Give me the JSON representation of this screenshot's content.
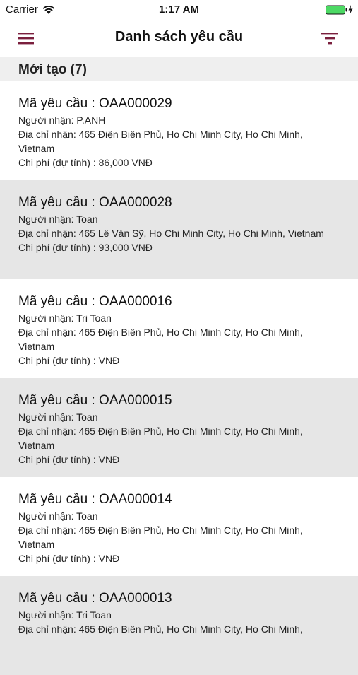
{
  "status_bar": {
    "carrier": "Carrier",
    "time": "1:17 AM"
  },
  "nav": {
    "title": "Danh sách yêu cầu",
    "menu_icon": "hamburger-menu-icon",
    "filter_icon": "filter-icon",
    "accent_color": "#7a1f3d"
  },
  "section": {
    "title": "Mới tạo (7)"
  },
  "labels": {
    "code": "Mã yêu cầu : ",
    "recipient": "Người nhận: ",
    "address": "Địa chỉ nhận: ",
    "cost": "Chi phí (dự tính) : "
  },
  "requests": [
    {
      "code": "Mã yêu cầu : OAA000029",
      "recipient": "Người nhận: P.ANH",
      "address": "Địa chỉ nhận: 465 Điện Biên Phủ, Ho Chi Minh City, Ho Chi Minh, Vietnam",
      "cost": "Chi phí (dự tính) : 86,000 VNĐ"
    },
    {
      "code": "Mã yêu cầu : OAA000028",
      "recipient": "Người nhận: Toan",
      "address": "Địa chỉ nhận: 465 Lê Văn Sỹ, Ho Chi Minh City, Ho Chi Minh, Vietnam",
      "cost": "Chi phí (dự tính) : 93,000 VNĐ"
    },
    {
      "code": "Mã yêu cầu : OAA000016",
      "recipient": "Người nhận: Tri Toan",
      "address": "Địa chỉ nhận: 465 Điện Biên Phủ, Ho Chi Minh City, Ho Chi Minh, Vietnam",
      "cost": "Chi phí (dự tính) :  VNĐ"
    },
    {
      "code": "Mã yêu cầu : OAA000015",
      "recipient": "Người nhận: Toan",
      "address": "Địa chỉ nhận: 465 Điện Biên Phủ, Ho Chi Minh City, Ho Chi Minh, Vietnam",
      "cost": "Chi phí (dự tính) :  VNĐ"
    },
    {
      "code": "Mã yêu cầu : OAA000014",
      "recipient": "Người nhận: Toan",
      "address": "Địa chỉ nhận: 465 Điện Biên Phủ, Ho Chi Minh City, Ho Chi Minh, Vietnam",
      "cost": "Chi phí (dự tính) :  VNĐ"
    },
    {
      "code": "Mã yêu cầu : OAA000013",
      "recipient": "Người nhận: Tri Toan",
      "address": "Địa chỉ nhận: 465 Điện Biên Phủ, Ho Chi Minh City, Ho Chi Minh,",
      "cost": ""
    }
  ]
}
